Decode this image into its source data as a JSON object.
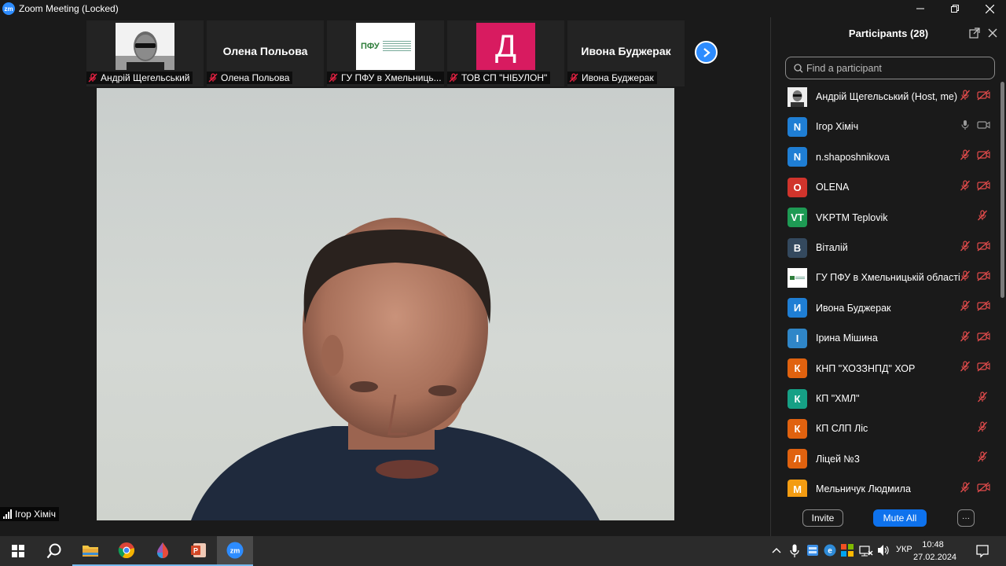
{
  "window": {
    "title": "Zoom Meeting (Locked)",
    "logo_text": "zm"
  },
  "thumbnails": [
    {
      "label": "Андрій Щегельський",
      "type": "photo"
    },
    {
      "label": "Олена Польова",
      "name_display": "Олена Польова",
      "type": "name"
    },
    {
      "label": "ГУ ПФУ в Хмельниць...",
      "logo_text": "ПФУ",
      "type": "logo"
    },
    {
      "label": "ТОВ СП \"НІБУЛОН\"",
      "letter": "Д",
      "type": "letter"
    },
    {
      "label": "Ивона Буджерак",
      "name_display": "Ивона Буджерак",
      "type": "name"
    }
  ],
  "active_speaker": {
    "name": "Ігор Хіміч"
  },
  "participants_panel": {
    "title": "Participants (28)",
    "search_placeholder": "Find a participant",
    "participants": [
      {
        "initial": "",
        "name": "Андрій Щегельський (Host, me)",
        "color": "#ffffff",
        "avatar": "photo",
        "mic": "muted",
        "video": "off"
      },
      {
        "initial": "N",
        "name": "Ігор Хіміч",
        "color": "#1f7ed4",
        "mic": "on",
        "video": "on"
      },
      {
        "initial": "N",
        "name": "n.shaposhnikova",
        "color": "#1f7ed4",
        "mic": "muted",
        "video": "off"
      },
      {
        "initial": "O",
        "name": "OLENA",
        "color": "#d0342c",
        "mic": "muted",
        "video": "off"
      },
      {
        "initial": "VT",
        "name": "VKPTM Teplovik",
        "color": "#1e9a54",
        "mic": "muted",
        "video": "none"
      },
      {
        "initial": "B",
        "name": "Віталій",
        "color": "#34495e",
        "mic": "muted",
        "video": "off"
      },
      {
        "initial": "",
        "name": "ГУ ПФУ в Хмельницькій області",
        "color": "#ffffff",
        "avatar": "logo",
        "mic": "muted",
        "video": "off"
      },
      {
        "initial": "И",
        "name": "Ивона Буджерак",
        "color": "#1f7ed4",
        "mic": "muted",
        "video": "off"
      },
      {
        "initial": "І",
        "name": "Ірина Мішина",
        "color": "#2f86c8",
        "mic": "muted",
        "video": "off"
      },
      {
        "initial": "К",
        "name": "КНП \"ХОЗЗНПД\" ХОР",
        "color": "#e0620f",
        "mic": "muted",
        "video": "off"
      },
      {
        "initial": "К",
        "name": "КП \"ХМЛ\"",
        "color": "#16a085",
        "mic": "muted",
        "video": "none"
      },
      {
        "initial": "К",
        "name": "КП СЛП Ліс",
        "color": "#e0620f",
        "mic": "muted",
        "video": "none"
      },
      {
        "initial": "Л",
        "name": "Ліцей №3",
        "color": "#e0620f",
        "mic": "muted",
        "video": "none"
      },
      {
        "initial": "М",
        "name": "Мельничук Людмила",
        "color": "#f39c12",
        "mic": "muted",
        "video": "off"
      }
    ],
    "invite_label": "Invite",
    "mute_all_label": "Mute All",
    "more_label": "···"
  },
  "taskbar": {
    "language": "УКР",
    "time": "10:48",
    "date": "27.02.2024",
    "apps": [
      "start-icon",
      "search-icon",
      "file-explorer-icon",
      "chrome-icon",
      "color-app-icon",
      "powerpoint-icon",
      "zoom-icon"
    ]
  }
}
